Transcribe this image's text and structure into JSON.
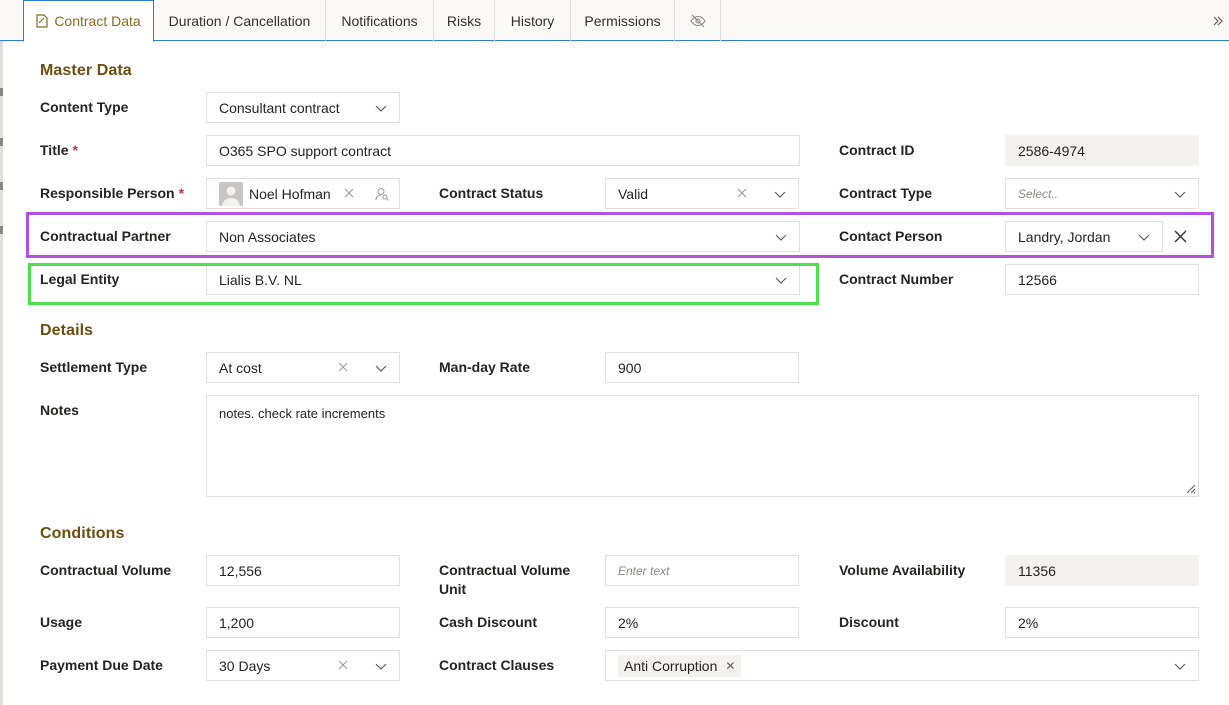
{
  "tabs": [
    {
      "label": "Contract Data",
      "active": true
    },
    {
      "label": "Duration / Cancellation"
    },
    {
      "label": "Notifications"
    },
    {
      "label": "Risks"
    },
    {
      "label": "History"
    },
    {
      "label": "Permissions"
    }
  ],
  "sections": {
    "master": "Master Data",
    "details": "Details",
    "conditions": "Conditions"
  },
  "fields": {
    "content_type": {
      "label": "Content Type",
      "value": "Consultant contract"
    },
    "title": {
      "label": "Title",
      "required": "*",
      "value": "O365 SPO support contract"
    },
    "contract_id": {
      "label": "Contract ID",
      "value": "2586-4974"
    },
    "responsible_person": {
      "label": "Responsible Person",
      "required": "*",
      "value": "Noel Hofman"
    },
    "contract_status": {
      "label": "Contract Status",
      "value": "Valid"
    },
    "contract_type": {
      "label": "Contract Type",
      "placeholder": "Select.."
    },
    "contractual_partner": {
      "label": "Contractual Partner",
      "value": "Non Associates"
    },
    "contact_person": {
      "label": "Contact Person",
      "value": "Landry, Jordan"
    },
    "legal_entity": {
      "label": "Legal Entity",
      "value": "Lialis B.V. NL"
    },
    "contract_number": {
      "label": "Contract Number",
      "value": "12566"
    },
    "settlement_type": {
      "label": "Settlement Type",
      "value": "At cost"
    },
    "man_day_rate": {
      "label": "Man-day Rate",
      "value": "900"
    },
    "notes": {
      "label": "Notes",
      "value": "notes. check rate increments"
    },
    "contractual_volume": {
      "label": "Contractual Volume",
      "value": "12,556"
    },
    "contractual_volume_unit": {
      "label_line1": "Contractual Volume",
      "label_line2": "Unit",
      "placeholder": "Enter text"
    },
    "volume_availability": {
      "label": "Volume Availability",
      "value": "11356"
    },
    "usage": {
      "label": "Usage",
      "value": "1,200"
    },
    "cash_discount": {
      "label": "Cash Discount",
      "value": "2%"
    },
    "discount": {
      "label": "Discount",
      "value": "2%"
    },
    "payment_due_date": {
      "label": "Payment Due Date",
      "value": "30 Days"
    },
    "contract_clauses": {
      "label": "Contract Clauses",
      "tags": [
        "Anti Corruption"
      ]
    }
  },
  "colors": {
    "accent": "#2b7cd3",
    "section_title": "#6b4f12",
    "highlight_purple": "#b44fe0",
    "highlight_green": "#4be04b"
  },
  "icons": {
    "tab_contract": "document-icon",
    "tab_hidden": "eye-off-icon",
    "more": "double-chevron-right-icon"
  }
}
